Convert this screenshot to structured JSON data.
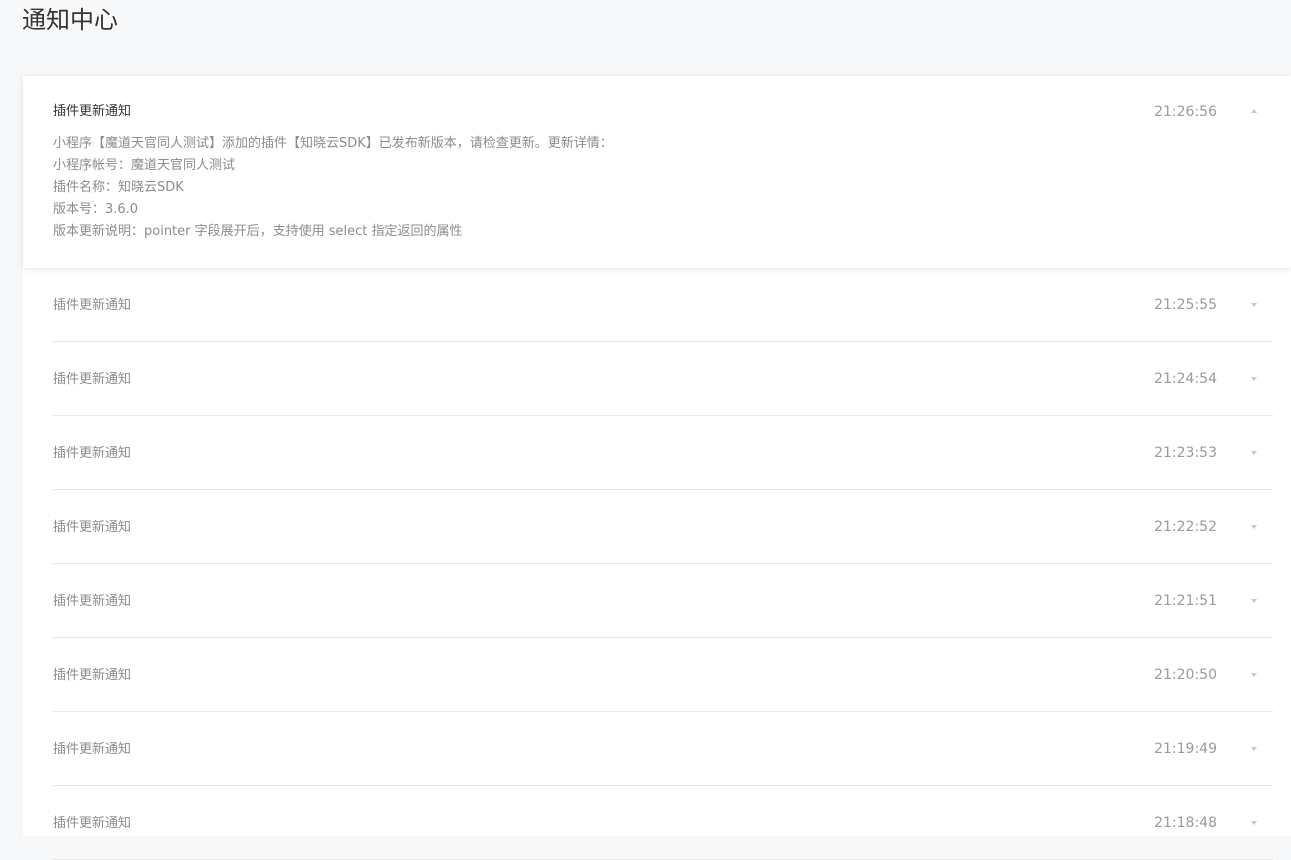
{
  "page": {
    "title": "通知中心"
  },
  "expanded_item": {
    "title": "插件更新通知",
    "time": "21:26:56",
    "toggle_icon": "chevron-up-icon",
    "body_lines": [
      "小程序【魔道天官同人测试】添加的插件【知晓云SDK】已发布新版本，请检查更新。更新详情：",
      "小程序帐号：魔道天官同人测试",
      "插件名称：知晓云SDK",
      "版本号：3.6.0",
      "版本更新说明：pointer 字段展开后，支持使用 select 指定返回的属性"
    ]
  },
  "items": [
    {
      "title": "插件更新通知",
      "time": "21:25:55"
    },
    {
      "title": "插件更新通知",
      "time": "21:24:54"
    },
    {
      "title": "插件更新通知",
      "time": "21:23:53"
    },
    {
      "title": "插件更新通知",
      "time": "21:22:52"
    },
    {
      "title": "插件更新通知",
      "time": "21:21:51"
    },
    {
      "title": "插件更新通知",
      "time": "21:20:50"
    },
    {
      "title": "插件更新通知",
      "time": "21:19:49"
    },
    {
      "title": "插件更新通知",
      "time": "21:18:48"
    }
  ],
  "colors": {
    "background": "#f7f8fa",
    "card": "#ffffff",
    "title_text": "#353535",
    "muted_text": "#8c8c8c",
    "divider": "#e7e7e7"
  }
}
